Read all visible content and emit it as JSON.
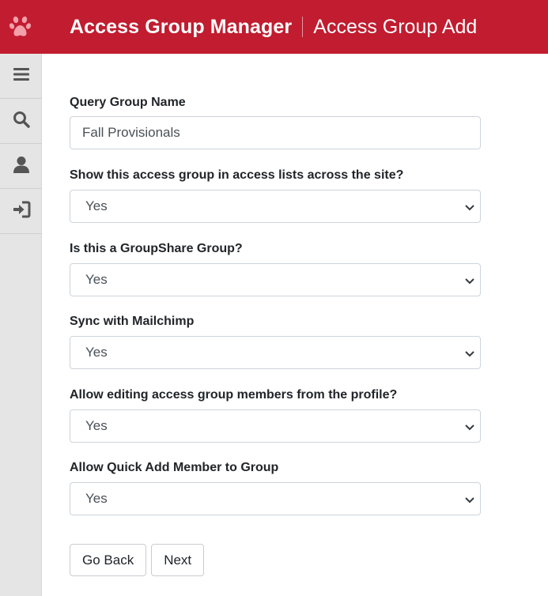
{
  "header": {
    "logo_icon": "paw-print-icon",
    "app_title": "Access Group Manager",
    "page_title": "Access Group Add",
    "brand_color": "#c11c2f"
  },
  "sidebar": {
    "items": [
      {
        "icon": "menu-icon"
      },
      {
        "icon": "search-icon"
      },
      {
        "icon": "user-icon"
      },
      {
        "icon": "sign-in-icon"
      }
    ]
  },
  "form": {
    "query_group_name": {
      "label": "Query Group Name",
      "value": "Fall Provisionals"
    },
    "show_in_access_lists": {
      "label": "Show this access group in access lists across the site?",
      "value": "Yes"
    },
    "groupshare_group": {
      "label": "Is this a GroupShare Group?",
      "value": "Yes"
    },
    "sync_mailchimp": {
      "label": "Sync with Mailchimp",
      "value": "Yes"
    },
    "allow_edit_from_profile": {
      "label": "Allow editing access group members from the profile?",
      "value": "Yes"
    },
    "allow_quick_add": {
      "label": "Allow Quick Add Member to Group",
      "value": "Yes"
    }
  },
  "actions": {
    "back_label": "Go Back",
    "next_label": "Next"
  }
}
